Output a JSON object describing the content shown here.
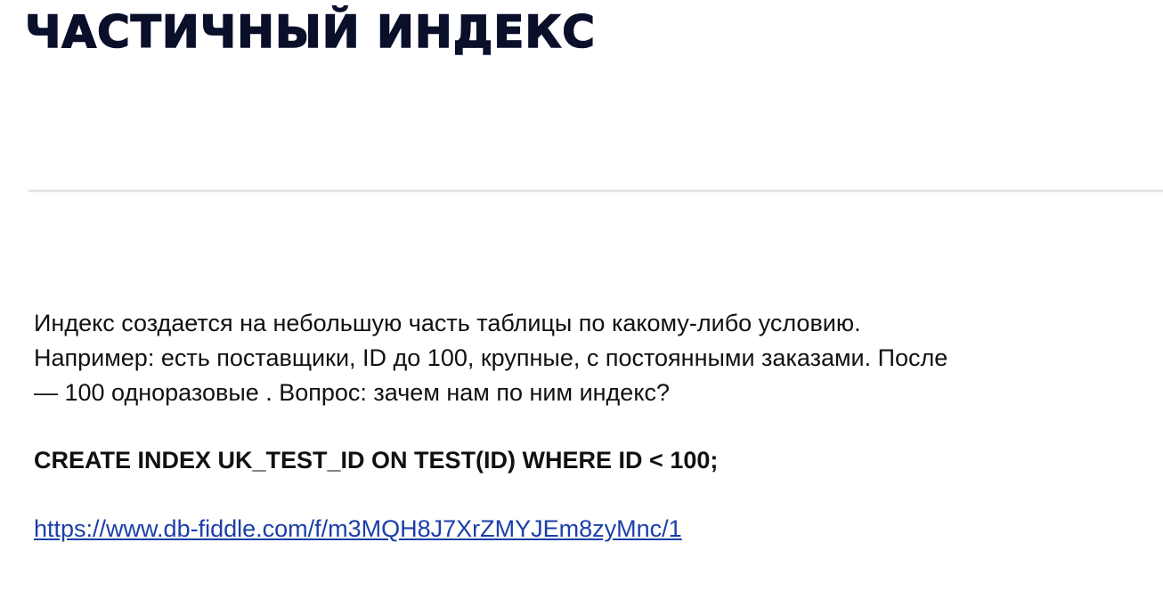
{
  "slide": {
    "title": "ЧАСТИЧНЫЙ ИНДЕКС",
    "body_lines": [
      "Индекс создается на небольшую часть таблицы по какому-либо условию.",
      "Например: есть поставщики, ID до 100, крупные, с постоянными заказами. После",
      "— 100 одноразовые . Вопрос: зачем нам по ним индекс?"
    ],
    "sql": "CREATE INDEX UK_TEST_ID ON TEST(ID) WHERE ID < 100;",
    "link_text": "https://www.db-fiddle.com/f/m3MQH8J7XrZMYJEm8zyMnc/1",
    "link_href": "https://www.db-fiddle.com/f/m3MQH8J7XrZMYJEm8zyMnc/1"
  },
  "colors": {
    "title": "#0a0f2a",
    "text": "#111111",
    "link": "#1a3fa8",
    "divider": "#e2e4e8"
  }
}
